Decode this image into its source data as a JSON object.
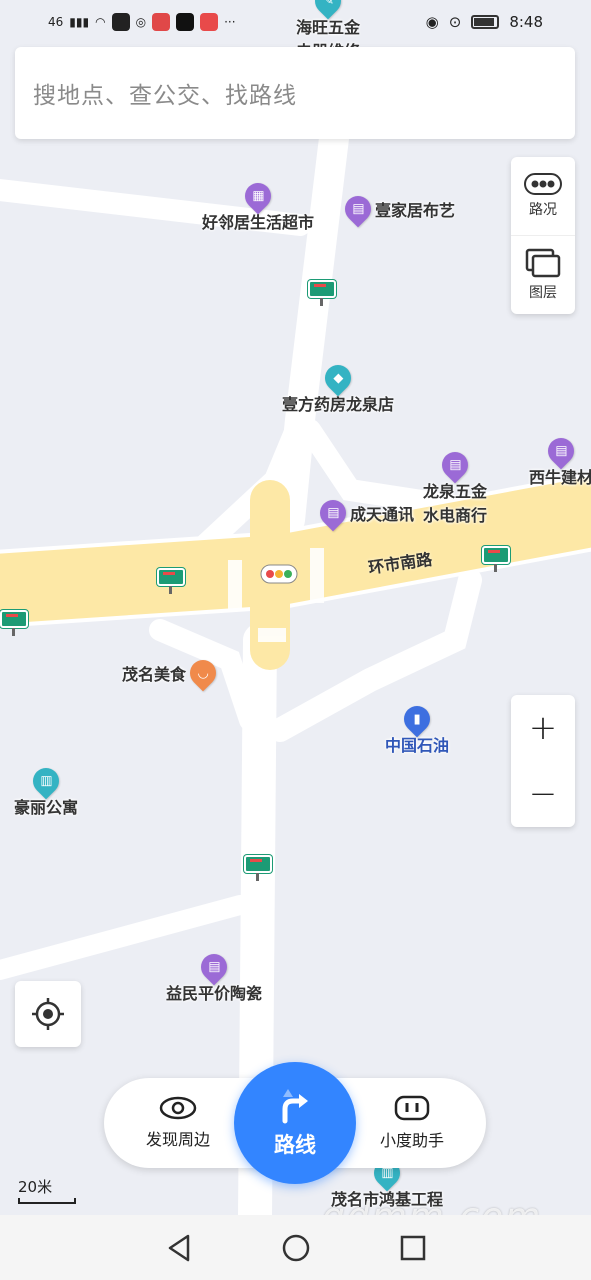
{
  "status_bar": {
    "network": "46",
    "more": "···",
    "time": "8:48"
  },
  "search": {
    "placeholder": "搜地点、查公交、找路线"
  },
  "right_controls": {
    "traffic_label": "路况",
    "layers_label": "图层",
    "zoom_in": "+",
    "zoom_out": "−"
  },
  "map": {
    "road_label": "环市南路",
    "pois": [
      {
        "name": "海旺五金",
        "sub": "电器维修",
        "color": "teal",
        "icon": "wrench-icon"
      },
      {
        "name": "好邻居生活超市",
        "color": "purple",
        "icon": "shopping-basket-icon"
      },
      {
        "name": "壹家居布艺",
        "color": "purple",
        "icon": "shopping-bag-icon"
      },
      {
        "name": "壹方药房龙泉店",
        "color": "teal",
        "icon": "pill-icon"
      },
      {
        "name": "龙泉五金",
        "color": "purple",
        "icon": "shopping-bag-icon"
      },
      {
        "name": "水电商行",
        "color": "purple",
        "icon": "shopping-bag-icon"
      },
      {
        "name": "西牛建材",
        "color": "purple",
        "icon": "shopping-bag-icon"
      },
      {
        "name": "成天通讯",
        "color": "purple",
        "icon": "shopping-bag-icon"
      },
      {
        "name": "茂名美食",
        "color": "orange",
        "icon": "food-bowl-icon"
      },
      {
        "name": "中国石油",
        "color": "blue",
        "icon": "gas-station-icon"
      },
      {
        "name": "豪丽公寓",
        "color": "teal",
        "icon": "building-icon"
      },
      {
        "name": "益民平价陶瓷",
        "color": "purple",
        "icon": "shopping-bag-icon"
      },
      {
        "name": "茂名市鸿基工程",
        "color": "teal",
        "icon": "building-icon"
      }
    ],
    "scale": "20米"
  },
  "action_bar": {
    "discover_label": "发现周边",
    "route_label": "路线",
    "assistant_label": "小度助手"
  },
  "watermark": "gdmm.com",
  "colors": {
    "accent": "#3385ff",
    "road_main": "#fde8a6",
    "road_minor": "#ffffff",
    "map_bg": "#eceef4"
  }
}
